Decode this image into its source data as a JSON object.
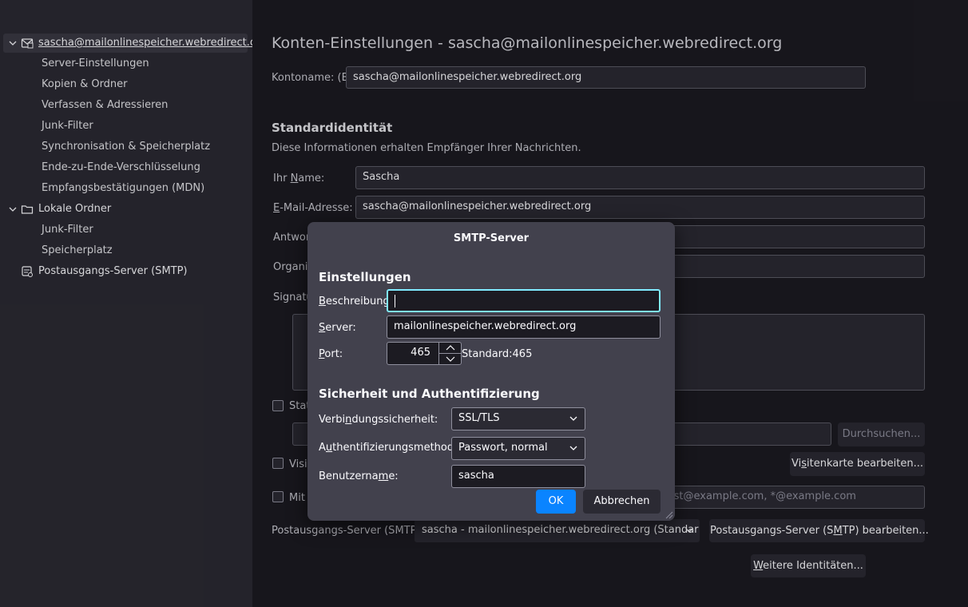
{
  "sidebar": {
    "account": "sascha@mailonlinespeicher.webredirect.org",
    "account_items": [
      "Server-Einstellungen",
      "Kopien & Ordner",
      "Verfassen & Adressieren",
      "Junk-Filter",
      "Synchronisation & Speicherplatz",
      "Ende-zu-Ende-Verschlüsselung",
      "Empfangsbestätigungen (MDN)"
    ],
    "local_folders": "Lokale Ordner",
    "local_items": [
      "Junk-Filter",
      "Speicherplatz"
    ],
    "smtp": "Postausgangs-Server (SMTP)"
  },
  "main": {
    "title": "Konten-Einstellungen - sascha@mailonlinespeicher.webredirect.org",
    "account_name_label": "Kontoname: (B)",
    "account_name_value": "sascha@mailonlinespeicher.webredirect.org",
    "identity_heading": "Standardidentität",
    "identity_desc": "Diese Informationen erhalten Empfänger Ihrer Nachrichten.",
    "name_label_pre": "Ihr ",
    "name_label_u": "N",
    "name_label_post": "ame:",
    "name_value": "Sascha",
    "email_label_u": "E",
    "email_label_post": "-Mail-Adresse:",
    "email_value": "sascha@mailonlinespeicher.webredirect.org",
    "reply_label_partial": "Antwor",
    "org_label_partial": "Organi",
    "sig_label_partial": "Signatu",
    "sig_check_partial": "Stat",
    "vcard_check_partial": "Visit",
    "mit_check_partial": "Mit",
    "browse_button": "Durchsuchen...",
    "vcard_button_pre": "Vi",
    "vcard_button_u": "s",
    "vcard_button_post": "itenkarte bearbeiten...",
    "aliases_placeholder_partial": "ist@example.com, *@example.com",
    "smtp_label": "Postausgangs-Server (SMTP):",
    "smtp_value": "sascha - mailonlinespeicher.webredirect.org (Standard)",
    "smtp_edit_pre": "Postausgangs-Server (S",
    "smtp_edit_u": "M",
    "smtp_edit_post": "TP) bearbeiten...",
    "more_identities_u": "W",
    "more_identities_post": "eitere Identitäten..."
  },
  "dialog": {
    "title": "SMTP-Server",
    "settings_heading": "Einstellungen",
    "desc_label_u": "B",
    "desc_label_post": "eschreibung:",
    "desc_value": "",
    "server_label_u": "S",
    "server_label_post": "erver:",
    "server_value": "mailonlinespeicher.webredirect.org",
    "port_label_u": "P",
    "port_label_post": "ort:",
    "port_value": "465",
    "port_default": "Standard:465",
    "security_heading": "Sicherheit und Authentifizierung",
    "conn_label_pre": "Verbi",
    "conn_label_u": "n",
    "conn_label_post": "dungssicherheit:",
    "conn_value": "SSL/TLS",
    "auth_label_pre": "A",
    "auth_label_u": "u",
    "auth_label_post": "thentifizierungsmethode:",
    "auth_value": "Passwort, normal",
    "user_label_pre": "Benutzerna",
    "user_label_u": "m",
    "user_label_post": "e:",
    "user_value": "sascha",
    "ok": "OK",
    "cancel": "Abbrechen"
  },
  "colors": {
    "accent": "#0df",
    "ok_button": "#0a84ff",
    "focus": "#80ebff"
  }
}
